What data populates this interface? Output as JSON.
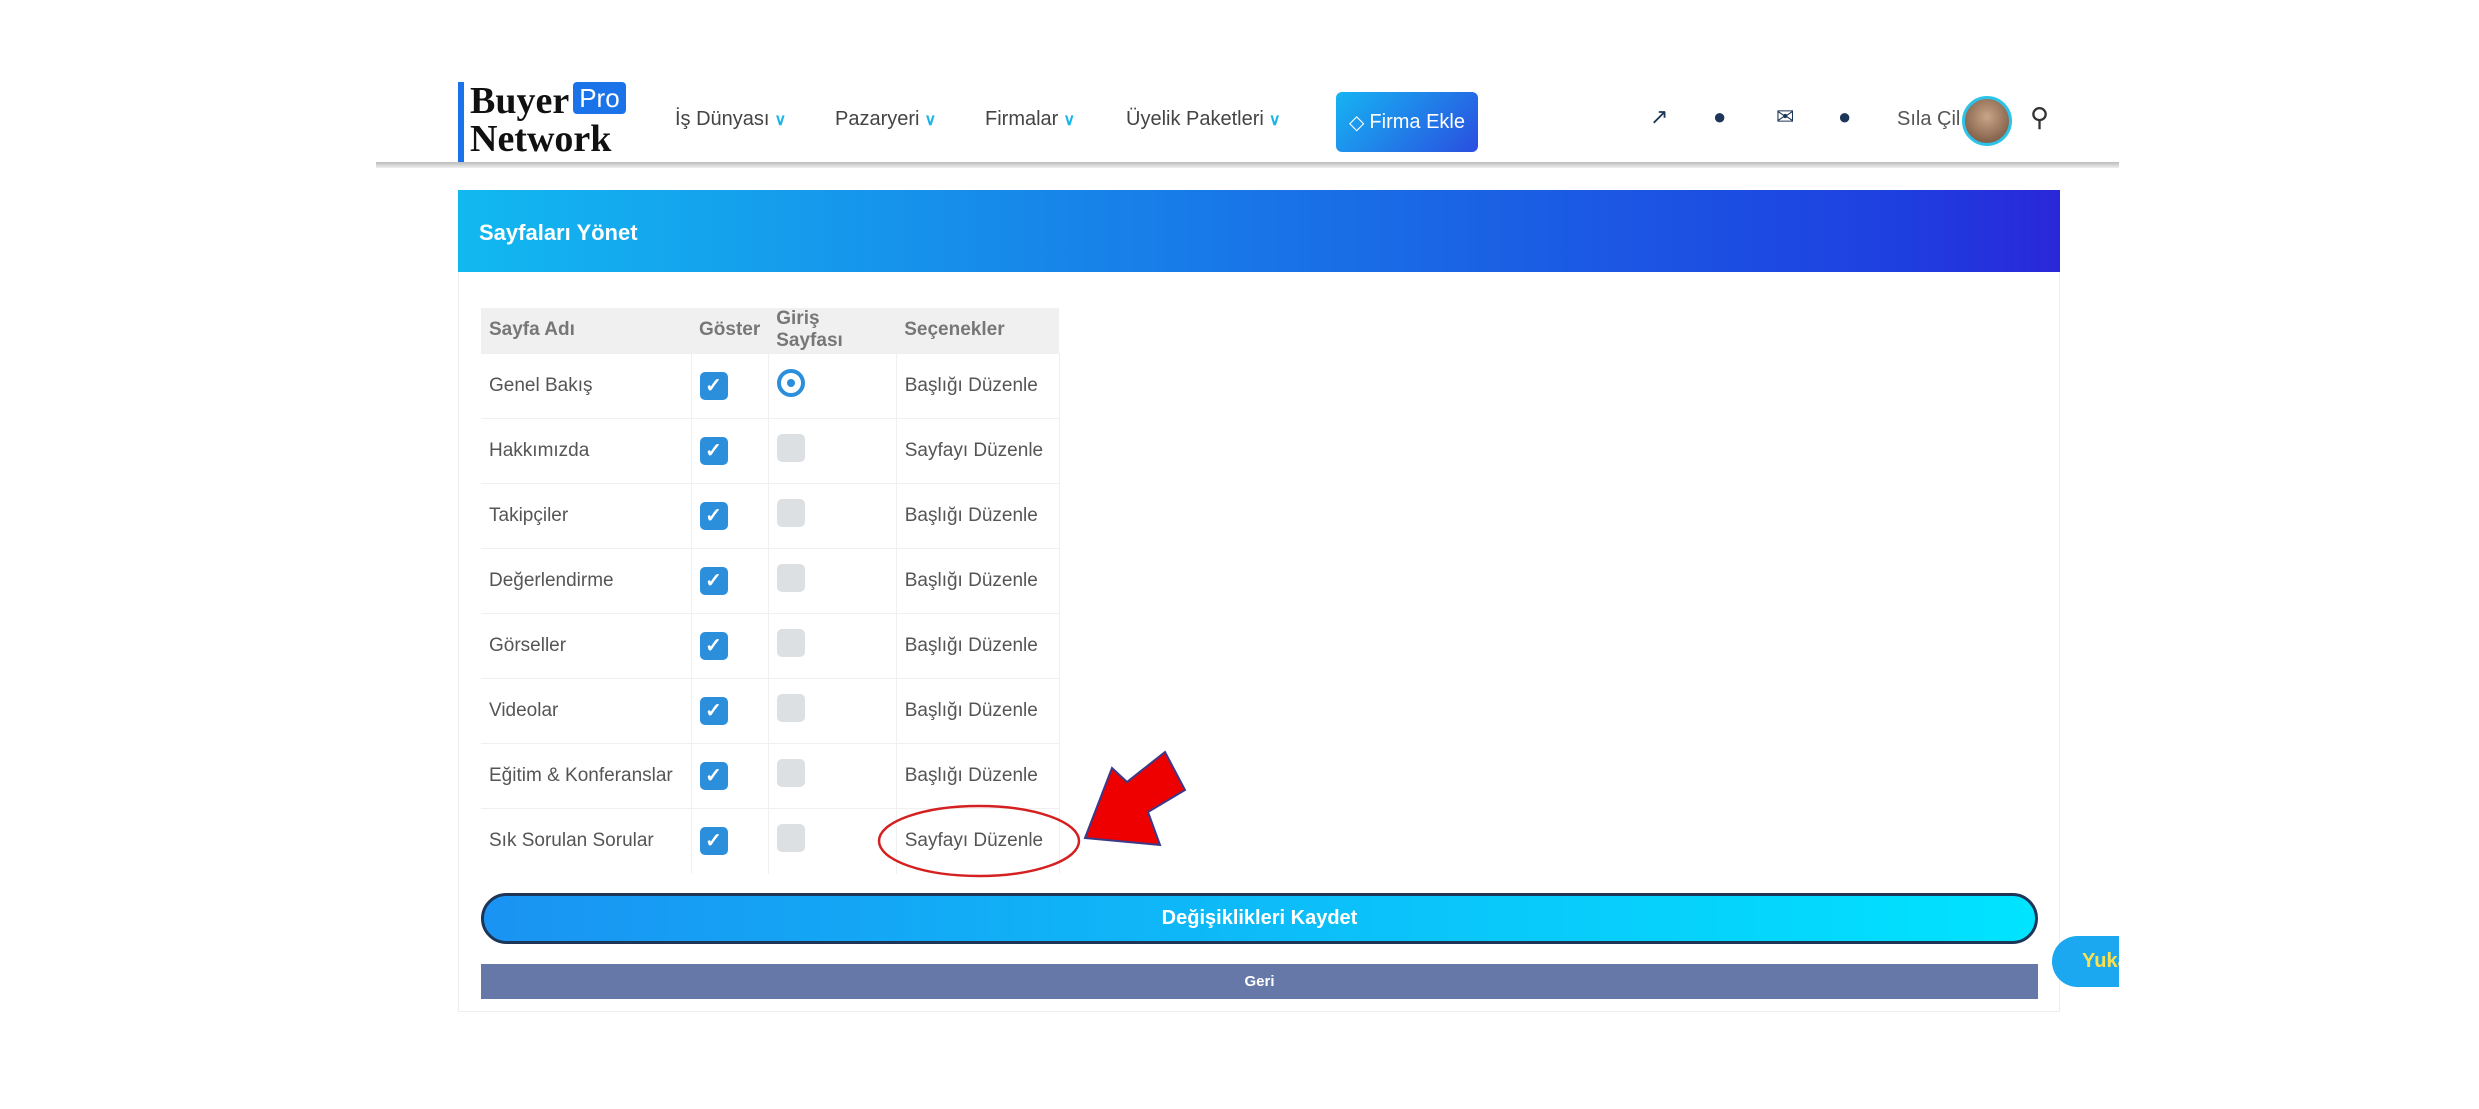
{
  "logo": {
    "line1": "Buyer",
    "badge": "Pro",
    "line2": "Network"
  },
  "nav": [
    {
      "label": "İş Dünyası"
    },
    {
      "label": "Pazaryeri"
    },
    {
      "label": "Firmalar"
    },
    {
      "label": "Üyelik Paketleri"
    }
  ],
  "firma_ekle": "Firma Ekle",
  "icons": [
    "external-link-icon",
    "users-icon",
    "envelope-icon",
    "globe-icon"
  ],
  "user": {
    "name": "Sıla Çil"
  },
  "panel": {
    "title": "Sayfaları Yönet"
  },
  "table": {
    "headers": [
      "Sayfa Adı",
      "Göster",
      "Giriş Sayfası",
      "Seçenekler"
    ],
    "rows": [
      {
        "name": "Genel Bakış",
        "show": true,
        "home": true,
        "option": "Başlığı Düzenle"
      },
      {
        "name": "Hakkımızda",
        "show": true,
        "home": false,
        "option": "Sayfayı Düzenle"
      },
      {
        "name": "Takipçiler",
        "show": true,
        "home": false,
        "option": "Başlığı Düzenle"
      },
      {
        "name": "Değerlendirme",
        "show": true,
        "home": false,
        "option": "Başlığı Düzenle"
      },
      {
        "name": "Görseller",
        "show": true,
        "home": false,
        "option": "Başlığı Düzenle"
      },
      {
        "name": "Videolar",
        "show": true,
        "home": false,
        "option": "Başlığı Düzenle"
      },
      {
        "name": "Eğitim & Konferanslar",
        "show": true,
        "home": false,
        "option": "Başlığı Düzenle"
      },
      {
        "name": "Sık Sorulan Sorular",
        "show": true,
        "home": false,
        "option": "Sayfayı Düzenle"
      }
    ]
  },
  "buttons": {
    "save": "Değişiklikleri Kaydet",
    "back": "Geri",
    "up": "Yukarı"
  },
  "colors": {
    "accent": "#2c8fdc",
    "annotation": "#e00000"
  }
}
